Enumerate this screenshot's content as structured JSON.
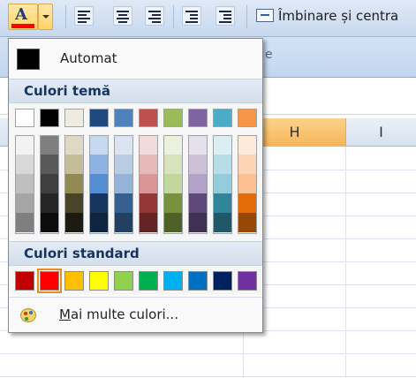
{
  "toolbar": {
    "font_color_letter": "A",
    "font_color_value": "#ff0000",
    "merge_label": "Îmbinare și centra"
  },
  "ribbon": {
    "group_fragment": "e"
  },
  "sheet": {
    "columns": [
      "H",
      "I"
    ],
    "selected_column": "H"
  },
  "palette": {
    "automatic": {
      "label": "Automat",
      "color": "#000000"
    },
    "theme_header": "Culori temă",
    "theme_top": [
      "#ffffff",
      "#000000",
      "#eeece1",
      "#1f497d",
      "#4f81bd",
      "#c0504d",
      "#9bbb59",
      "#8064a2",
      "#4bacc6",
      "#f79646"
    ],
    "theme_shades": [
      [
        "#f2f2f2",
        "#d8d8d8",
        "#bfbfbf",
        "#a5a5a5",
        "#7f7f7f"
      ],
      [
        "#7f7f7f",
        "#595959",
        "#3f3f3f",
        "#262626",
        "#0c0c0c"
      ],
      [
        "#ddd9c3",
        "#c4bd97",
        "#938953",
        "#494429",
        "#1d1b10"
      ],
      [
        "#c6d9f0",
        "#8db3e2",
        "#548dd4",
        "#17365d",
        "#0f243e"
      ],
      [
        "#dbe5f1",
        "#b8cce4",
        "#95b3d7",
        "#366092",
        "#244061"
      ],
      [
        "#f2dcdb",
        "#e5b9b7",
        "#d99694",
        "#953734",
        "#632423"
      ],
      [
        "#ebf1dd",
        "#d7e3bc",
        "#c3d69b",
        "#76923c",
        "#4f6128"
      ],
      [
        "#e5e0ec",
        "#ccc1d9",
        "#b2a2c7",
        "#5f497a",
        "#3f3151"
      ],
      [
        "#dbeef3",
        "#b7dde8",
        "#92cddc",
        "#31859b",
        "#205867"
      ],
      [
        "#fdeada",
        "#fbd5b5",
        "#fac08f",
        "#e36c09",
        "#974806"
      ]
    ],
    "standard_header": "Culori standard",
    "standard": [
      "#c00000",
      "#ff0000",
      "#ffc000",
      "#ffff00",
      "#92d050",
      "#00b050",
      "#00b0f0",
      "#0070c0",
      "#002060",
      "#7030a0"
    ],
    "selected_standard_index": 1,
    "more_colors": {
      "access_key": "M",
      "rest": "ai multe culori..."
    }
  }
}
